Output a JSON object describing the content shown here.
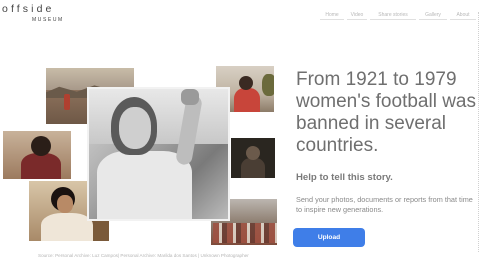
{
  "logo": {
    "top": "offside",
    "sub": "MUSEUM"
  },
  "nav": {
    "items": [
      "Home",
      "Video",
      "Share stories",
      "Gallery",
      "About"
    ]
  },
  "hero": {
    "headline": "From 1921 to 1979 women's football was banned in several countries.",
    "subhead": "Help to tell this story.",
    "body": "Send your photos, documents or reports from that time to inspire new generations.",
    "button": "Upload"
  },
  "source": "Source: Personal Archive: Luz Campos| Personal Archive: Marilda dos Santos | Unknown Photographer"
}
